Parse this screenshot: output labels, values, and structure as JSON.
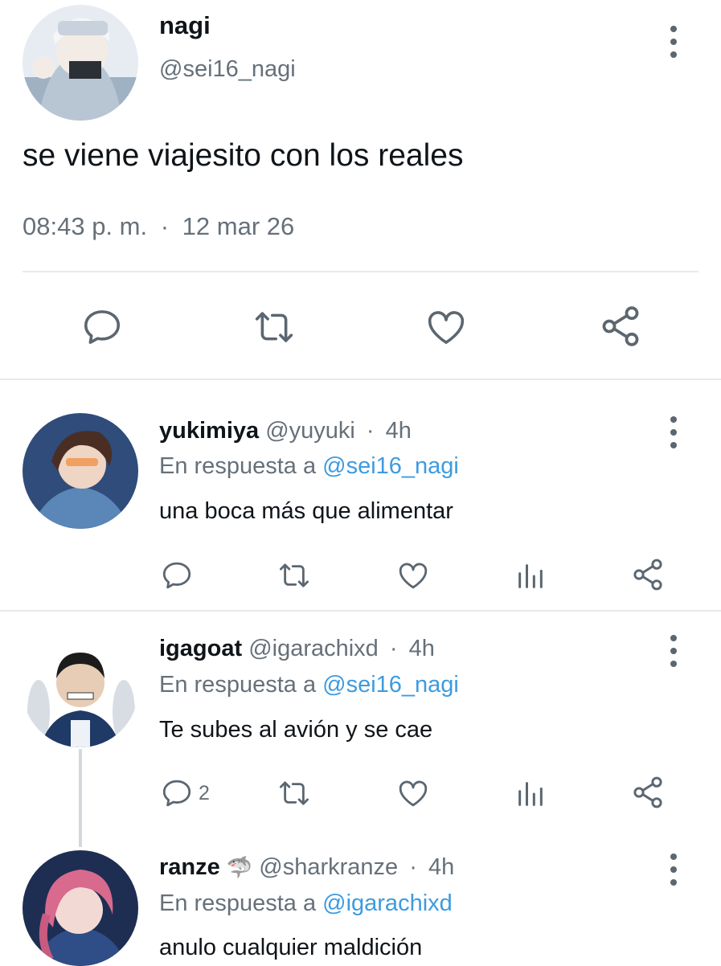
{
  "main_post": {
    "display_name": "nagi",
    "handle": "@sei16_nagi",
    "text": "se viene viajesito con los reales",
    "time": "08:43 p. m.",
    "separator": "·",
    "date": "12 mar 26",
    "actions": [
      "reply-icon",
      "retweet-icon",
      "like-icon",
      "share-icon"
    ]
  },
  "replies": [
    {
      "display_name": "yukimiya",
      "emoji": "",
      "handle": "@yuyuki",
      "separator": "·",
      "age": "4h",
      "reply_prefix": "En respuesta a",
      "reply_to": "@sei16_nagi",
      "text": "una boca más que alimentar",
      "reply_count": ""
    },
    {
      "display_name": "igagoat",
      "emoji": "",
      "handle": "@igarachixd",
      "separator": "·",
      "age": "4h",
      "reply_prefix": "En respuesta a",
      "reply_to": "@sei16_nagi",
      "text": "Te subes al avión y se cae",
      "reply_count": "2"
    },
    {
      "display_name": "ranze",
      "emoji": "🦈",
      "handle": "@sharkranze",
      "separator": "·",
      "age": "4h",
      "reply_prefix": "En respuesta a",
      "reply_to": "@igarachixd",
      "text": "anulo cualquier maldición",
      "reply_count": ""
    }
  ],
  "colors": {
    "link": "#3d9be0",
    "secondary_text": "#66707a",
    "icon": "#5b6670",
    "divider": "#e7eaec"
  }
}
